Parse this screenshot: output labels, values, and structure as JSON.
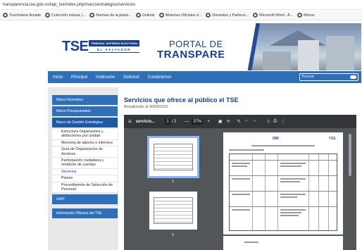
{
  "browser": {
    "url": "transparencia.tse.gob.sv/laip_tse/index.php/marcoestrategico/servicios",
    "bookmarks": [
      {
        "icon": "globe-icon",
        "label": "Touchstone Arcade"
      },
      {
        "icon": "globe-icon",
        "label": "Colección educar |..."
      },
      {
        "icon": "globe-icon",
        "label": "Normas de la platat..."
      },
      {
        "icon": "globe-icon",
        "label": "Outlook"
      },
      {
        "icon": "globe-icon",
        "label": "Misiones Oficiales d..."
      },
      {
        "icon": "globe-icon",
        "label": "Donantes y Particos..."
      },
      {
        "icon": "globe-icon",
        "label": "Microsoft Word - A..."
      },
      {
        "icon": "globe-icon",
        "label": "Micros"
      }
    ]
  },
  "header": {
    "logo_text": "TSE",
    "logo_box_top": "TRIBUNAL SUPREMO ELECTORAL",
    "logo_box_bottom": "EL SALVADOR",
    "portal_line1": "PORTAL DE",
    "portal_line2": "TRANSPARENCIA"
  },
  "nav": {
    "items": [
      "Inicio",
      "Principal",
      "Institución",
      "Solicitud",
      "Contáctenos"
    ],
    "search_placeholder": "Buscar"
  },
  "sidebar": {
    "items": [
      {
        "label": "Marco Normativo"
      },
      {
        "label": "Marco Presupuestario"
      },
      {
        "label": "Marco de Gestión Estratégica"
      }
    ],
    "subitems": [
      "Estructura Organizativa y atribuciones por unidad",
      "Memoria de labores e informes",
      "Guía de Organización de Archivos",
      "Participación ciudadana y rendición de cuentas",
      "Servicios",
      "Planes",
      "Procedimiento de Selección de Personal"
    ],
    "bottom_items": [
      "UAIP",
      "Información Oficiosa del TSE"
    ]
  },
  "main": {
    "title": "Servicios que ofrece al público el TSE",
    "updated": "Actualizado al 30/09/2021"
  },
  "pdf_viewer": {
    "menu_icon": "hamburger-icon",
    "filename": "servicio...",
    "page_current": "1",
    "page_total": "/ 2",
    "zoom_minus": "—",
    "zoom": "37%",
    "zoom_plus": "+",
    "thumbnails": [
      "1",
      "2"
    ],
    "doc_logo_left": "OIR",
    "doc_logo_right": "TSE"
  }
}
